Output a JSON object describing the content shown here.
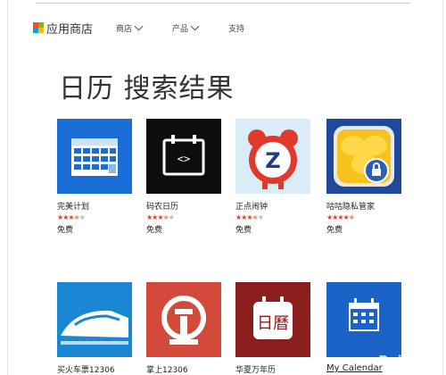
{
  "header": {
    "logo_text": "应用商店",
    "nav": [
      {
        "label": "商店"
      },
      {
        "label": "产品"
      },
      {
        "label": "支持"
      }
    ]
  },
  "page_title": "日历 搜索结果",
  "apps_row1": [
    {
      "name": "完美计划",
      "rating": 3.5,
      "price": "免费",
      "icon": "calendar-grid-icon",
      "color": "#1a6dd6"
    },
    {
      "name": "码农日历",
      "rating": 3.5,
      "price": "免费",
      "icon": "code-calendar-icon",
      "color": "#111111"
    },
    {
      "name": "正点闹钟",
      "rating": 3.5,
      "price": "免费",
      "icon": "alarm-clock-icon",
      "color": "#d9ecf8"
    },
    {
      "name": "咕咕隐私管家",
      "rating": 4.5,
      "price": "免费",
      "icon": "flower-lock-icon",
      "color": "#1f4a9c"
    }
  ],
  "apps_row2": [
    {
      "name": "买火车票12306",
      "icon": "bullet-train-icon",
      "color": "#1a87d4"
    },
    {
      "name": "掌上12306",
      "icon": "railway-logo-icon",
      "color": "#d44a3a"
    },
    {
      "name": "华夏万年历",
      "icon": "chinese-calendar-icon",
      "color": "#8b1d1d"
    },
    {
      "name": "My Calendar",
      "icon": "calendar-icon",
      "color": "#1b63c6"
    }
  ],
  "watermark": "Bai 经验"
}
